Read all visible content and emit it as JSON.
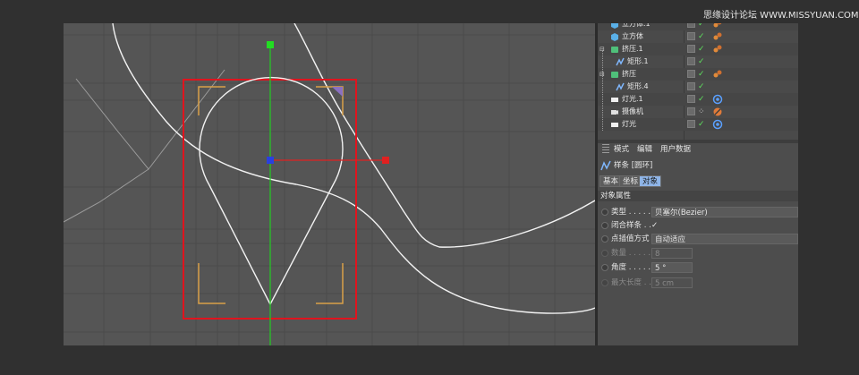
{
  "watermark": "思缘设计论坛 WWW.MISSYUAN.COM",
  "object_manager": {
    "rows": [
      {
        "name": "立方体.1",
        "icon": "cube-icon"
      },
      {
        "name": "立方体",
        "icon": "cube-icon"
      },
      {
        "name": "挤压.1",
        "icon": "extrude-icon"
      },
      {
        "name": "矩形.1",
        "icon": "spline-icon"
      },
      {
        "name": "挤压",
        "icon": "extrude-icon"
      },
      {
        "name": "矩形.4",
        "icon": "spline-icon"
      },
      {
        "name": "灯光.1",
        "icon": "light-icon"
      },
      {
        "name": "摄像机",
        "icon": "camera-icon"
      },
      {
        "name": "灯光",
        "icon": "light-icon"
      }
    ]
  },
  "attributes": {
    "menu": [
      "模式",
      "编辑",
      "用户数据"
    ],
    "object_title": "样条 [圆环]",
    "tabs": [
      "基本",
      "坐标",
      "对象"
    ],
    "active_tab": "对象",
    "section_title": "对象属性",
    "props": [
      {
        "label": "类型 . . . . . . .",
        "value": "贝塞尔(Bezier)",
        "enabled": true
      },
      {
        "label": "闭合样条 . .",
        "value": "✓",
        "enabled": true
      },
      {
        "label": "点插值方式",
        "value": "自动适应",
        "enabled": true
      },
      {
        "label": "数量 . . . . . .",
        "value": "8",
        "enabled": false
      },
      {
        "label": "角度 . . . . . .",
        "value": "5 °",
        "enabled": true
      },
      {
        "label": "最大长度 . .",
        "value": "5 cm",
        "enabled": false
      }
    ]
  },
  "colors": {
    "selection_box": "#e0141e",
    "axis_y": "#22cc22",
    "axis_x": "#e02020",
    "axis_center": "#2a40e0",
    "bracket": "#d9a048",
    "spline": "#f2f2f2",
    "active_tab": "#8fb5e8"
  }
}
